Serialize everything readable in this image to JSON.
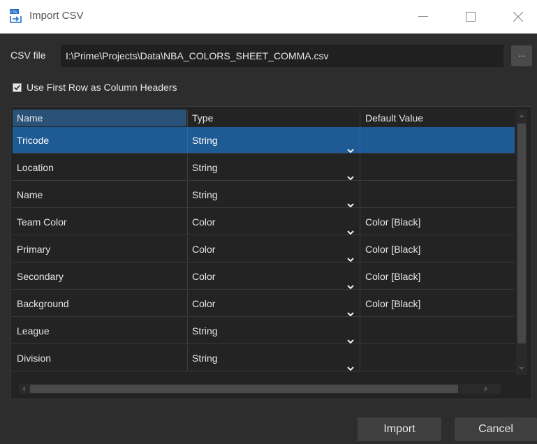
{
  "window": {
    "title": "Import CSV",
    "app_icon": "csv-import-icon",
    "controls": [
      "minimize-icon",
      "maximize-icon",
      "close-icon"
    ]
  },
  "csv_file": {
    "label": "CSV file",
    "value": "I:\\Prime\\Projects\\Data\\NBA_COLORS_SHEET_COMMA.csv",
    "browse_label": "..."
  },
  "use_first_row": {
    "checked": true,
    "label": "Use First Row as Column Headers"
  },
  "table": {
    "headers": {
      "name": "Name",
      "type": "Type",
      "default": "Default Value"
    },
    "rows": [
      {
        "name": "Tricode",
        "type": "String",
        "default": ""
      },
      {
        "name": "Location",
        "type": "String",
        "default": ""
      },
      {
        "name": "Name",
        "type": "String",
        "default": ""
      },
      {
        "name": "Team Color",
        "type": "Color",
        "default": "Color [Black]"
      },
      {
        "name": "Primary",
        "type": "Color",
        "default": "Color [Black]"
      },
      {
        "name": "Secondary",
        "type": "Color",
        "default": "Color [Black]"
      },
      {
        "name": "Background",
        "type": "Color",
        "default": "Color [Black]"
      },
      {
        "name": "League",
        "type": "String",
        "default": ""
      },
      {
        "name": "Division",
        "type": "String",
        "default": ""
      }
    ],
    "selected_row": 0
  },
  "buttons": {
    "import": "Import",
    "cancel": "Cancel"
  },
  "colors": {
    "accent_selected": "#1e5a93",
    "header_selected": "#2a5278",
    "background": "#2d2d2d"
  }
}
